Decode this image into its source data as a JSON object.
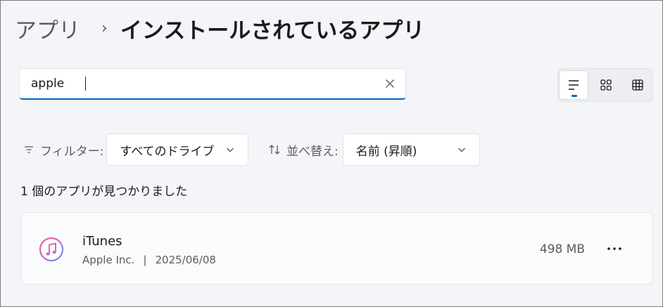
{
  "breadcrumb": {
    "parent": "アプリ",
    "separator": "›",
    "current": "インストールされているアプリ"
  },
  "search": {
    "value": "apple",
    "clear_icon": "close-icon"
  },
  "view_toggle": {
    "options": [
      {
        "icon": "list-view-icon",
        "active": true
      },
      {
        "icon": "grid-view-icon",
        "active": false
      },
      {
        "icon": "tile-view-icon",
        "active": false
      }
    ]
  },
  "filter": {
    "icon": "filter-icon",
    "label": "フィルター:",
    "value": "すべてのドライブ"
  },
  "sort": {
    "icon": "sort-icon",
    "label": "並べ替え:",
    "value": "名前 (昇順)"
  },
  "result_count": "1 個のアプリが見つかりました",
  "apps": [
    {
      "name": "iTunes",
      "publisher": "Apple Inc.",
      "separator": "|",
      "date": "2025/06/08",
      "size": "498 MB",
      "icon": "itunes-icon",
      "more_icon": "more-options-icon"
    }
  ],
  "colors": {
    "accent": "#0067c0",
    "background": "#f3f5f9",
    "card": "#fafbfc"
  }
}
